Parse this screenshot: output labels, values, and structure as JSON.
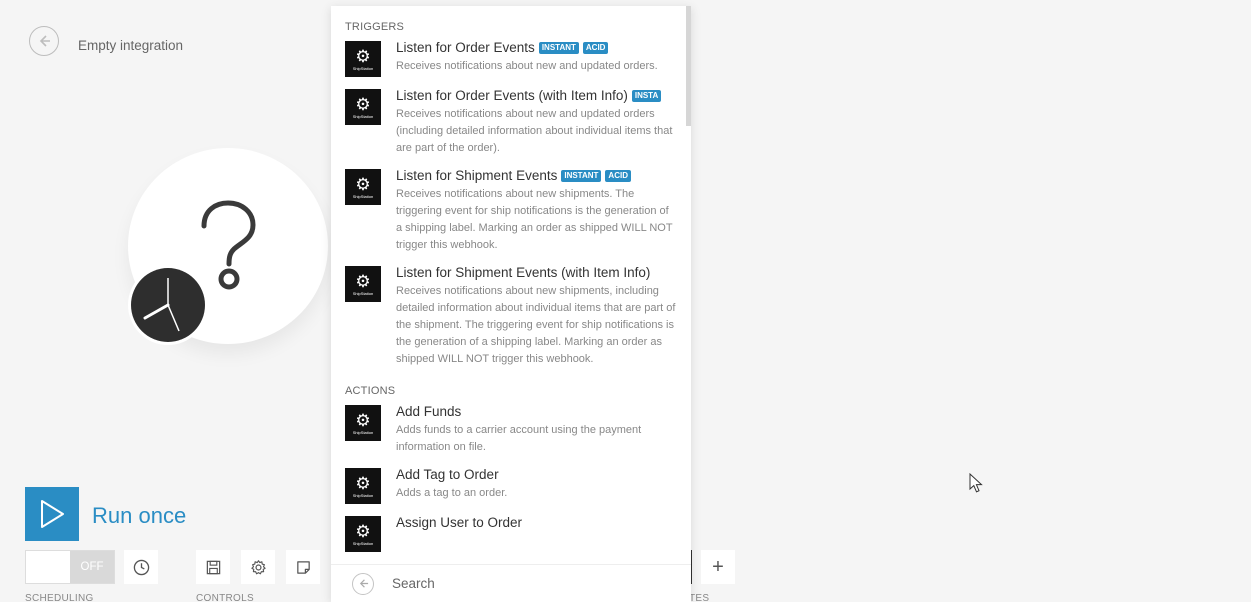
{
  "header": {
    "title": "Empty integration"
  },
  "controls": {
    "run_label": "Run once",
    "scheduling_state": "OFF",
    "scheduling_label": "SCHEDULING",
    "controls_label": "CONTROLS",
    "favorites_label": "TES"
  },
  "panel": {
    "triggers_label": "TRIGGERS",
    "actions_label": "ACTIONS",
    "brand_text": "ShipStation",
    "search_placeholder": "Search",
    "triggers": [
      {
        "title": "Listen for Order Events",
        "badges": [
          "INSTANT",
          "ACID"
        ],
        "description": "Receives notifications about new and updated orders."
      },
      {
        "title": "Listen for Order Events (with Item Info)",
        "badges": [
          "INSTA"
        ],
        "description": "Receives notifications about new and updated orders (including detailed information about individual items that are part of the order)."
      },
      {
        "title": "Listen for Shipment Events",
        "badges": [
          "INSTANT",
          "ACID"
        ],
        "description": "Receives notifications about new shipments. The triggering event for ship notifications is the generation of a shipping label. Marking an order as shipped WILL NOT trigger this webhook."
      },
      {
        "title": "Listen for Shipment Events (with Item Info)",
        "badges": [],
        "description": "Receives notifications about new shipments, including detailed information about individual items that are part of the shipment. The triggering event for ship notifications is the generation of a shipping label. Marking an order as shipped WILL NOT trigger this webhook."
      }
    ],
    "actions": [
      {
        "title": "Add Funds",
        "description": "Adds funds to a carrier account using the payment information on file."
      },
      {
        "title": "Add Tag to Order",
        "description": "Adds a tag to an order."
      },
      {
        "title": "Assign User to Order",
        "description": ""
      }
    ]
  },
  "colors": {
    "accent": "#2a8dc4",
    "icon_bg": "#111111"
  }
}
